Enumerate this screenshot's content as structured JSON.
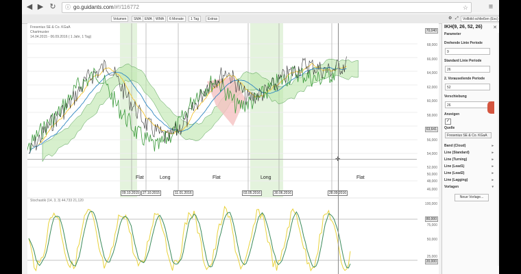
{
  "browser": {
    "url_host": "go.guidants.com",
    "url_path": "/#!/116772"
  },
  "toolbar": {
    "buttons": [
      "Volumen",
      "SMA",
      "EMA",
      "WMA",
      "6 Monate",
      "1 Tag",
      "Extras"
    ],
    "right_button": "Vollbild schließen (Esc)"
  },
  "chart": {
    "legend": [
      "Fresenius SE & Co. KGaA",
      "Chartmuster",
      "14.04.2015 - 06.09.2016 ( 1 Jahr, 1 Tag)"
    ],
    "y_ticks": [
      "68,000",
      "66,000",
      "64,000",
      "62,000",
      "60,000",
      "58,000",
      "56,000",
      "54,000",
      "52,000",
      "50,000",
      "48,000",
      "46,000"
    ],
    "y_badges": [
      "70,040",
      "63,641"
    ],
    "phases": [
      "Flat",
      "Long",
      "Flat",
      "Long",
      "Flat"
    ],
    "dates": [
      "09.10.2015",
      "27.10.2015",
      "11.01.2016",
      "03.05.2016",
      "30.06.2016",
      "28.09.2016"
    ],
    "colors": {
      "long_band": "#e4f3dd",
      "cloud": "#b6e3a4",
      "cloud_red": "#f5c2c2",
      "price": "#333333",
      "tenkan": "#f4c430",
      "kijun": "#2e86c1",
      "lagging": "#3a9a3a"
    }
  },
  "sub": {
    "legend": "Stochastik (14, 3, 3) 44,733  21,120",
    "y_ticks": [
      "100,000",
      "75,000",
      "50,000",
      "25,000"
    ],
    "y_badges": [
      "80,000",
      "20,000"
    ]
  },
  "panel": {
    "title": "IKH(9, 26, 52, 26)",
    "section": "Parameter",
    "fields": [
      {
        "label": "Drehende Linie Periode",
        "value": "9"
      },
      {
        "label": "Standard Linie Periode",
        "value": "26"
      },
      {
        "label": "2. Vorauseilende Periode",
        "value": "52"
      },
      {
        "label": "Verschiebung",
        "value": "26"
      }
    ],
    "anzeigen_label": "Anzeigen",
    "anzeigen_checked": "✓",
    "quelle_label": "Quelle",
    "quelle_value": "Fresenius SE & Co. KGaA",
    "rows": [
      "Band (Cloud)",
      "Line (Standard)",
      "Line (Turning)",
      "Line (Lead1)",
      "Line (Lead2)",
      "Line (Lagging)",
      "Vorlagen"
    ],
    "button": "Neue Vorlage..."
  }
}
